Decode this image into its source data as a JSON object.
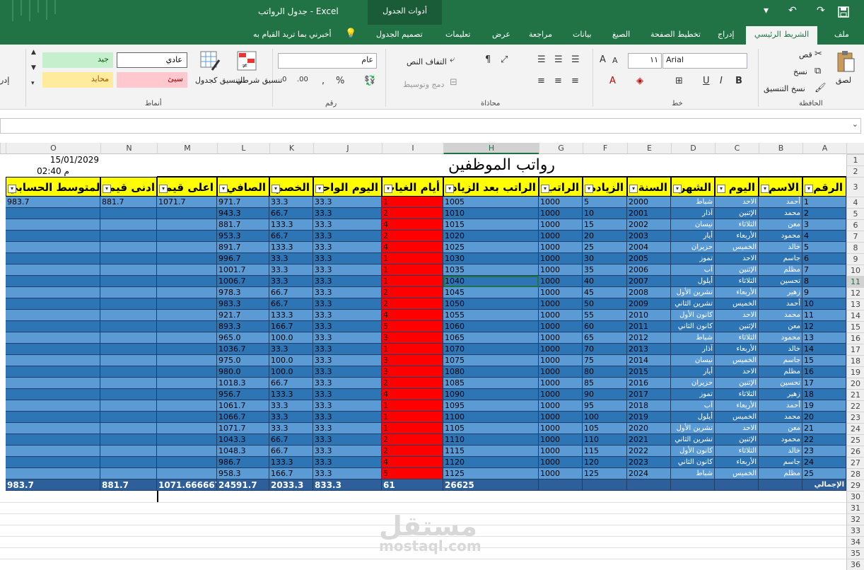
{
  "window": {
    "title": "جدول الرواتب  -  Excel",
    "table_tools_tab": "أدوات الجدول",
    "qat": [
      "save-icon",
      "undo-icon",
      "redo-icon",
      "customize-icon"
    ]
  },
  "tabs": [
    {
      "label": "ملف"
    },
    {
      "label": "الشريط الرئيسي",
      "active": true
    },
    {
      "label": "إدراج"
    },
    {
      "label": "تخطيط الصفحة"
    },
    {
      "label": "الصيغ"
    },
    {
      "label": "بيانات"
    },
    {
      "label": "مراجعة"
    },
    {
      "label": "عرض"
    },
    {
      "label": "تعليمات"
    },
    {
      "label": "تصميم الجدول"
    }
  ],
  "tell_me": "أخبرني بما تريد القيام به",
  "ribbon": {
    "clipboard": {
      "label": "الحافظة",
      "paste": "لصق",
      "cut": "قص",
      "copy": "نسخ",
      "format_painter": "نسخ التنسيق"
    },
    "font": {
      "label": "خط",
      "name": "Arial",
      "size": "١١",
      "bold": "B",
      "italic": "I",
      "underline": "U"
    },
    "alignment": {
      "label": "محاذاة",
      "wrap": "التفاف النص",
      "merge": "دمج وتوسيط"
    },
    "number": {
      "label": "رقم",
      "format": "عام"
    },
    "styles": {
      "label": "أنماط",
      "conditional": "تنسيق شرطي",
      "as_table": "التنسيق كجدول",
      "normal": "عادي",
      "good": "جيد",
      "bad": "سيئ",
      "neutral": "محايد"
    },
    "cells": {
      "insert": "إدر"
    }
  },
  "grid": {
    "columns": [
      "O",
      "N",
      "M",
      "L",
      "K",
      "J",
      "I",
      "H",
      "G",
      "F",
      "E",
      "D",
      "C",
      "B",
      "A"
    ],
    "selected_column": "H",
    "title": "رواتب الموظفين",
    "date": "15/01/2029",
    "time": "م 02:40",
    "headers": {
      "O": "المتوسط الحسابي",
      "N": "ادنى قيمة",
      "M": "اعلى قيمة",
      "L": "الصافي",
      "K": "الخصم",
      "J": "اليوم الواحد",
      "I": "أيام الغياب",
      "H": "الراتب بعد الزيادة",
      "G": "الراتب",
      "F": "الزيادة",
      "E": "السنة",
      "D": "الشهر",
      "C": "اليوم",
      "B": "الاسم",
      "A": "الرقم"
    },
    "summary": {
      "O": "983.7",
      "N": "881.7",
      "M": "1071.7"
    },
    "rows": [
      {
        "A": "1",
        "B": "أحمد",
        "C": "الاحد",
        "D": "شباط",
        "E": "2000",
        "F": "5",
        "G": "1000",
        "H": "1005",
        "I": "1",
        "J": "33.3",
        "K": "33.3",
        "L": "971.7"
      },
      {
        "A": "2",
        "B": "محمد",
        "C": "الإثنين",
        "D": "آذار",
        "E": "2001",
        "F": "10",
        "G": "1000",
        "H": "1010",
        "I": "2",
        "J": "33.3",
        "K": "66.7",
        "L": "943.3"
      },
      {
        "A": "3",
        "B": "معن",
        "C": "الثلاثاء",
        "D": "نيسان",
        "E": "2002",
        "F": "15",
        "G": "1000",
        "H": "1015",
        "I": "4",
        "J": "33.3",
        "K": "133.3",
        "L": "881.7"
      },
      {
        "A": "4",
        "B": "محمود",
        "C": "الأربعاء",
        "D": "أيار",
        "E": "2003",
        "F": "20",
        "G": "1000",
        "H": "1020",
        "I": "2",
        "J": "33.3",
        "K": "66.7",
        "L": "953.3"
      },
      {
        "A": "5",
        "B": "خالد",
        "C": "الخميس",
        "D": "حزيران",
        "E": "2004",
        "F": "25",
        "G": "1000",
        "H": "1025",
        "I": "4",
        "J": "33.3",
        "K": "133.3",
        "L": "891.7"
      },
      {
        "A": "6",
        "B": "جاسم",
        "C": "الاحد",
        "D": "تموز",
        "E": "2005",
        "F": "30",
        "G": "1000",
        "H": "1030",
        "I": "1",
        "J": "33.3",
        "K": "33.3",
        "L": "996.7"
      },
      {
        "A": "7",
        "B": "مظلم",
        "C": "الإثنين",
        "D": "آب",
        "E": "2006",
        "F": "35",
        "G": "1000",
        "H": "1035",
        "I": "1",
        "J": "33.3",
        "K": "33.3",
        "L": "1001.7"
      },
      {
        "A": "8",
        "B": "تحسين",
        "C": "الثلاثاء",
        "D": "أيلول",
        "E": "2007",
        "F": "40",
        "G": "1000",
        "H": "1040",
        "I": "1",
        "J": "33.3",
        "K": "33.3",
        "L": "1006.7"
      },
      {
        "A": "9",
        "B": "زهير",
        "C": "الأربعاء",
        "D": "تشرين الأول",
        "E": "2008",
        "F": "45",
        "G": "1000",
        "H": "1045",
        "I": "2",
        "J": "33.3",
        "K": "66.7",
        "L": "978.3"
      },
      {
        "A": "10",
        "B": "أحمد",
        "C": "الخميس",
        "D": "تشرين الثاني",
        "E": "2009",
        "F": "50",
        "G": "1000",
        "H": "1050",
        "I": "2",
        "J": "33.3",
        "K": "66.7",
        "L": "983.3"
      },
      {
        "A": "11",
        "B": "محمد",
        "C": "الاحد",
        "D": "كانون الأول",
        "E": "2010",
        "F": "55",
        "G": "1000",
        "H": "1055",
        "I": "4",
        "J": "33.3",
        "K": "133.3",
        "L": "921.7"
      },
      {
        "A": "12",
        "B": "معن",
        "C": "الإثنين",
        "D": "كانون الثاني",
        "E": "2011",
        "F": "60",
        "G": "1000",
        "H": "1060",
        "I": "5",
        "J": "33.3",
        "K": "166.7",
        "L": "893.3"
      },
      {
        "A": "13",
        "B": "محمود",
        "C": "الثلاثاء",
        "D": "شباط",
        "E": "2012",
        "F": "65",
        "G": "1000",
        "H": "1065",
        "I": "3",
        "J": "33.3",
        "K": "100.0",
        "L": "965.0"
      },
      {
        "A": "14",
        "B": "خالد",
        "C": "الأربعاء",
        "D": "آذار",
        "E": "2013",
        "F": "70",
        "G": "1000",
        "H": "1070",
        "I": "1",
        "J": "33.3",
        "K": "33.3",
        "L": "1036.7"
      },
      {
        "A": "15",
        "B": "جاسم",
        "C": "الخميس",
        "D": "نيسان",
        "E": "2014",
        "F": "75",
        "G": "1000",
        "H": "1075",
        "I": "3",
        "J": "33.3",
        "K": "100.0",
        "L": "975.0"
      },
      {
        "A": "16",
        "B": "مظلم",
        "C": "الاحد",
        "D": "أيار",
        "E": "2015",
        "F": "80",
        "G": "1000",
        "H": "1080",
        "I": "3",
        "J": "33.3",
        "K": "100.0",
        "L": "980.0"
      },
      {
        "A": "17",
        "B": "تحسين",
        "C": "الإثنين",
        "D": "حزيران",
        "E": "2016",
        "F": "85",
        "G": "1000",
        "H": "1085",
        "I": "2",
        "J": "33.3",
        "K": "66.7",
        "L": "1018.3"
      },
      {
        "A": "18",
        "B": "زهير",
        "C": "الثلاثاء",
        "D": "تموز",
        "E": "2017",
        "F": "90",
        "G": "1000",
        "H": "1090",
        "I": "4",
        "J": "33.3",
        "K": "133.3",
        "L": "956.7"
      },
      {
        "A": "19",
        "B": "أحمد",
        "C": "الأربعاء",
        "D": "آب",
        "E": "2018",
        "F": "95",
        "G": "1000",
        "H": "1095",
        "I": "1",
        "J": "33.3",
        "K": "33.3",
        "L": "1061.7"
      },
      {
        "A": "20",
        "B": "محمد",
        "C": "الخميس",
        "D": "أيلول",
        "E": "2019",
        "F": "100",
        "G": "1000",
        "H": "1100",
        "I": "1",
        "J": "33.3",
        "K": "33.3",
        "L": "1066.7"
      },
      {
        "A": "21",
        "B": "معن",
        "C": "الاحد",
        "D": "تشرين الأول",
        "E": "2020",
        "F": "105",
        "G": "1000",
        "H": "1105",
        "I": "1",
        "J": "33.3",
        "K": "33.3",
        "L": "1071.7"
      },
      {
        "A": "22",
        "B": "محمود",
        "C": "الإثنين",
        "D": "تشرين الثاني",
        "E": "2021",
        "F": "110",
        "G": "1000",
        "H": "1110",
        "I": "2",
        "J": "33.3",
        "K": "66.7",
        "L": "1043.3"
      },
      {
        "A": "23",
        "B": "خالد",
        "C": "الثلاثاء",
        "D": "كانون الأول",
        "E": "2022",
        "F": "115",
        "G": "1000",
        "H": "1115",
        "I": "2",
        "J": "33.3",
        "K": "66.7",
        "L": "1048.3"
      },
      {
        "A": "24",
        "B": "جاسم",
        "C": "الأربعاء",
        "D": "كانون الثاني",
        "E": "2023",
        "F": "120",
        "G": "1000",
        "H": "1120",
        "I": "4",
        "J": "33.3",
        "K": "133.3",
        "L": "986.7"
      },
      {
        "A": "25",
        "B": "مظلم",
        "C": "الخميس",
        "D": "شباط",
        "E": "2024",
        "F": "125",
        "G": "1000",
        "H": "1125",
        "I": "5",
        "J": "33.3",
        "K": "166.7",
        "L": "958.3"
      }
    ],
    "totals": {
      "A": "الإجمالي",
      "H": "26625",
      "I": "61",
      "J": "833.3",
      "K": "2033.3",
      "L": "24591.7",
      "M": "1071.666667",
      "N": "881.7",
      "O": "983.7"
    },
    "row_numbers": [
      "1",
      "2",
      "3",
      "4",
      "5",
      "6",
      "7",
      "8",
      "9",
      "10",
      "11",
      "12",
      "13",
      "14",
      "15",
      "16",
      "17",
      "18",
      "19",
      "20",
      "21",
      "22",
      "23",
      "24",
      "25",
      "26",
      "27",
      "28",
      "29",
      "30",
      "31",
      "32",
      "33",
      "34",
      "35",
      "36"
    ],
    "selected_row": "11",
    "active_cell_row": 8,
    "active_cell_col": "H",
    "colors": {
      "row_light": "#5b9bd5",
      "row_dark": "#2e75b6",
      "absent": "#ff0000",
      "header": "#ffff00",
      "excel_green": "#217346"
    }
  },
  "watermark": {
    "ar": "مستقل",
    "en": "mostaql.com"
  }
}
